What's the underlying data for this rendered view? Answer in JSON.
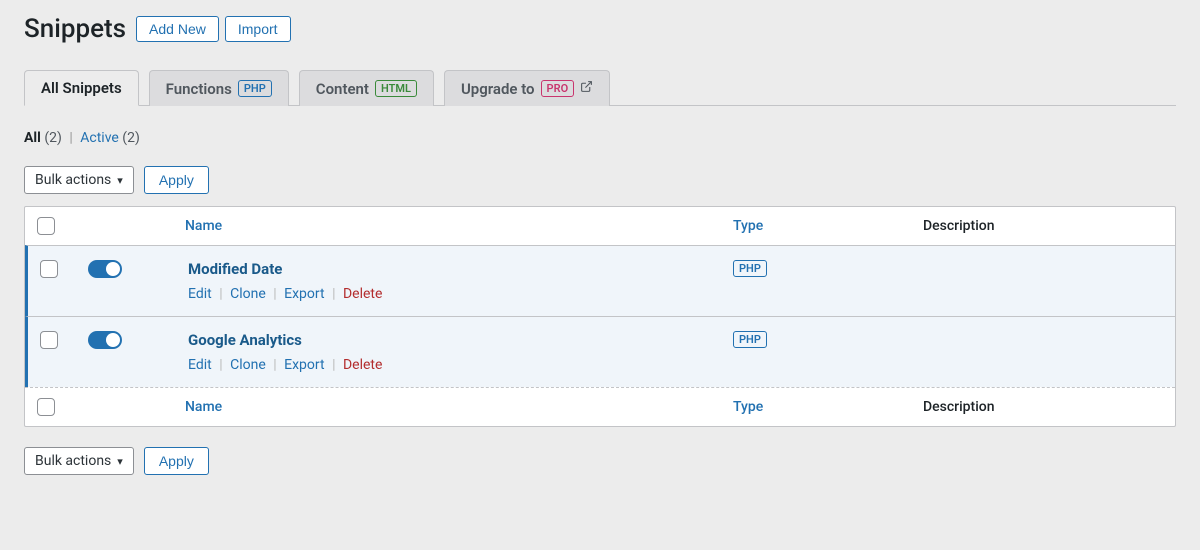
{
  "header": {
    "title": "Snippets",
    "add_new": "Add New",
    "import": "Import"
  },
  "tabs": [
    {
      "label": "All Snippets",
      "badge": null,
      "active": true
    },
    {
      "label": "Functions",
      "badge": "PHP",
      "badge_class": "badge-php",
      "active": false
    },
    {
      "label": "Content",
      "badge": "HTML",
      "badge_class": "badge-html",
      "active": false
    },
    {
      "label": "Upgrade to",
      "badge": "PRO",
      "badge_class": "badge-pro",
      "active": false,
      "external": true
    }
  ],
  "filters": {
    "all_label": "All",
    "all_count": "(2)",
    "active_label": "Active",
    "active_count": "(2)"
  },
  "bulk": {
    "select_label": "Bulk actions",
    "apply_label": "Apply"
  },
  "columns": {
    "name": "Name",
    "type": "Type",
    "description": "Description"
  },
  "rows": [
    {
      "title": "Modified Date",
      "type": "PHP",
      "actions": {
        "edit": "Edit",
        "clone": "Clone",
        "export": "Export",
        "delete": "Delete"
      }
    },
    {
      "title": "Google Analytics",
      "type": "PHP",
      "actions": {
        "edit": "Edit",
        "clone": "Clone",
        "export": "Export",
        "delete": "Delete"
      }
    }
  ]
}
